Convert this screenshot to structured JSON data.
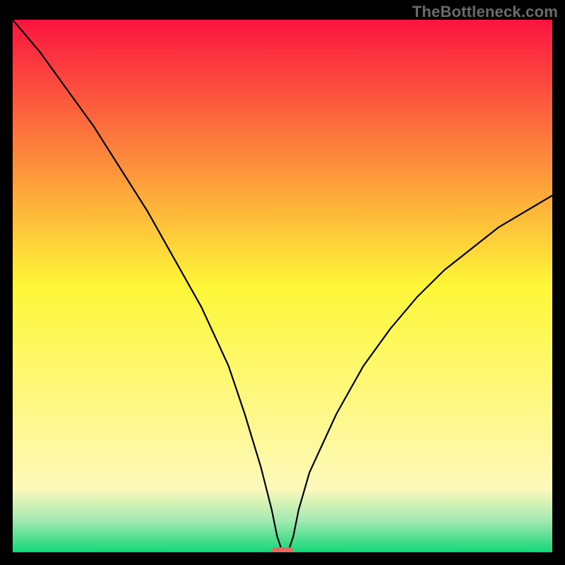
{
  "watermark": "TheBottleneck.com",
  "chart_data": {
    "type": "line",
    "title": "",
    "xlabel": "",
    "ylabel": "",
    "xlim": [
      0,
      100
    ],
    "ylim": [
      0,
      100
    ],
    "grid": false,
    "legend": false,
    "series": [
      {
        "name": "curve",
        "x": [
          0,
          5,
          10,
          15,
          20,
          25,
          30,
          35,
          40,
          43,
          46,
          48,
          49,
          50,
          51,
          52,
          53,
          55,
          60,
          65,
          70,
          75,
          80,
          85,
          90,
          95,
          100
        ],
        "values": [
          100,
          94,
          87,
          80,
          72,
          64,
          55,
          46,
          35,
          26,
          16,
          8,
          3,
          0,
          0,
          3,
          8,
          15,
          26,
          35,
          42,
          48,
          53,
          57,
          61,
          64,
          67
        ]
      }
    ],
    "marker": {
      "x": 50,
      "y": 0,
      "color": "#e46a5e"
    },
    "background_gradient": {
      "stops": [
        {
          "offset": 0.0,
          "color": "#fb1440"
        },
        {
          "offset": 0.5,
          "color": "#fef738"
        },
        {
          "offset": 0.88,
          "color": "#fef9ba"
        },
        {
          "offset": 0.94,
          "color": "#a4e9b2"
        },
        {
          "offset": 1.0,
          "color": "#12d677"
        }
      ]
    }
  }
}
